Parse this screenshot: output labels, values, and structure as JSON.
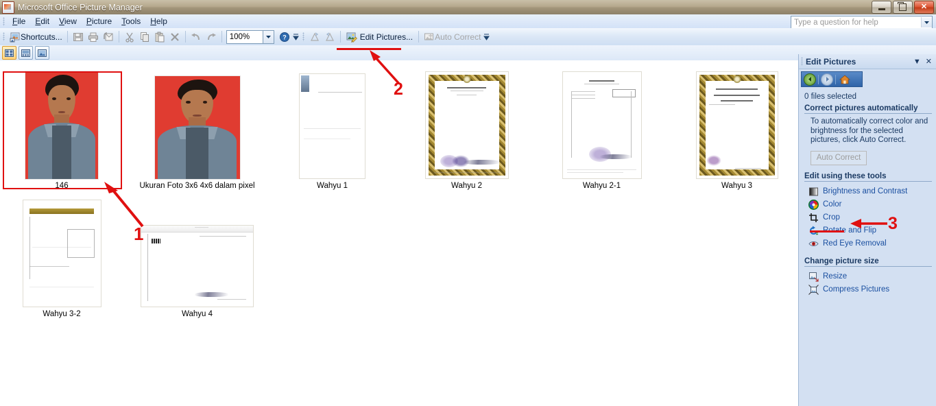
{
  "window": {
    "title": "Microsoft Office Picture Manager",
    "app_icon": "picture-manager-icon",
    "minimize_label": "Minimize",
    "restore_label": "Restore",
    "close_label": "Close"
  },
  "menu": {
    "items": [
      {
        "label": "File",
        "accel": "F"
      },
      {
        "label": "Edit",
        "accel": "E"
      },
      {
        "label": "View",
        "accel": "V"
      },
      {
        "label": "Picture",
        "accel": "P"
      },
      {
        "label": "Tools",
        "accel": "T"
      },
      {
        "label": "Help",
        "accel": "H"
      }
    ],
    "help_box": {
      "placeholder": "Type a question for help",
      "value": ""
    }
  },
  "toolbar": {
    "shortcuts_label": "Shortcuts...",
    "save_label": "Save",
    "print_label": "Print",
    "email_label": "E-mail",
    "cut_label": "Cut",
    "copy_label": "Copy",
    "paste_label": "Paste",
    "delete_label": "Delete",
    "undo_label": "Undo",
    "redo_label": "Redo",
    "zoom_value": "100%",
    "help_label": "Help",
    "rotate_left_label": "Rotate Left",
    "rotate_right_label": "Rotate Right",
    "edit_pictures_label": "Edit Pictures...",
    "auto_correct_label": "Auto Correct"
  },
  "view_strip": {
    "thumbnail_view_label": "Thumbnail View",
    "filmstrip_view_label": "Filmstrip View",
    "single_picture_view_label": "Single Picture View"
  },
  "thumbnails": [
    {
      "caption": "146",
      "kind": "photo",
      "selected": true
    },
    {
      "caption": "Ukuran Foto 3x6 4x6 dalam pixel",
      "kind": "photo",
      "selected": false
    },
    {
      "caption": "Wahyu 1",
      "kind": "doc-blank",
      "selected": false
    },
    {
      "caption": "Wahyu 2",
      "kind": "doc-certificate",
      "selected": false
    },
    {
      "caption": "Wahyu 2-1",
      "kind": "doc-letter",
      "selected": false
    },
    {
      "caption": "Wahyu 3",
      "kind": "doc-certificate",
      "selected": false
    },
    {
      "caption": "Wahyu 3-2",
      "kind": "doc-gold",
      "selected": false
    },
    {
      "caption": "Wahyu 4",
      "kind": "doc-landscape",
      "selected": false
    }
  ],
  "task_pane": {
    "title": "Edit Pictures",
    "dropdown_icon": "chevron-down-icon",
    "close_icon": "close-icon",
    "nav": {
      "back_label": "Back",
      "forward_label": "Forward",
      "home_label": "Home"
    },
    "status": "0 files selected",
    "sections": [
      {
        "heading": "Correct pictures automatically",
        "paragraph": "To automatically correct color and brightness for the selected pictures, click Auto Correct.",
        "button": "Auto Correct"
      },
      {
        "heading": "Edit using these tools",
        "tools": [
          {
            "label": "Brightness and Contrast",
            "icon": "brightness-contrast-icon"
          },
          {
            "label": "Color",
            "icon": "color-wheel-icon"
          },
          {
            "label": "Crop",
            "icon": "crop-icon"
          },
          {
            "label": "Rotate and Flip",
            "icon": "rotate-flip-icon"
          },
          {
            "label": "Red Eye Removal",
            "icon": "red-eye-icon"
          }
        ]
      },
      {
        "heading": "Change picture size",
        "tools": [
          {
            "label": "Resize",
            "icon": "resize-icon"
          },
          {
            "label": "Compress Pictures",
            "icon": "compress-icon"
          }
        ]
      }
    ]
  },
  "annotations": {
    "color": "#e01010",
    "steps": [
      {
        "number": "1",
        "target": "selected-thumbnail-146"
      },
      {
        "number": "2",
        "target": "edit-pictures-button"
      },
      {
        "number": "3",
        "target": "crop-tool"
      }
    ]
  }
}
